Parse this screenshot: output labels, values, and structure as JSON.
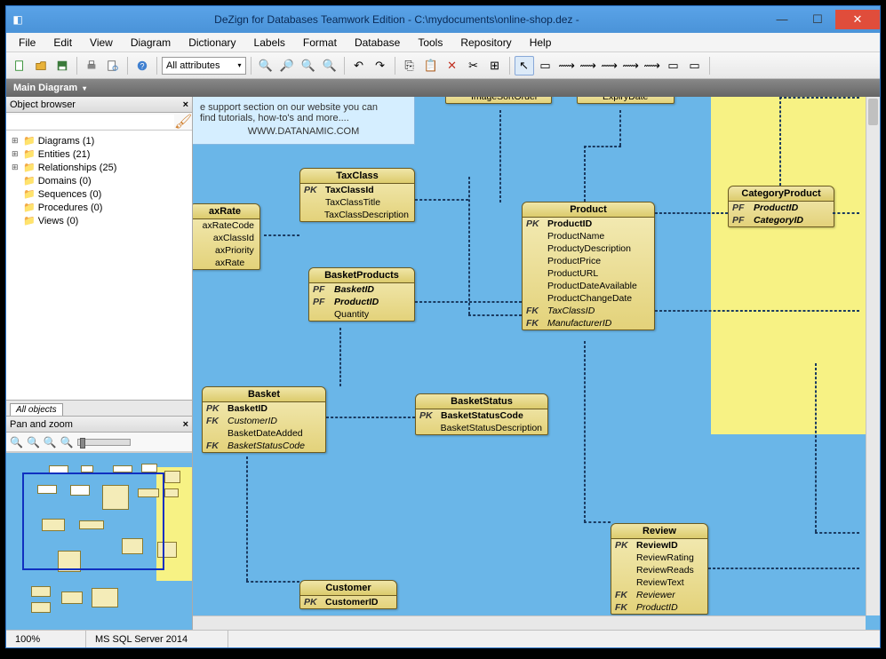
{
  "window": {
    "title": "DeZign for Databases Teamwork Edition - C:\\mydocuments\\online-shop.dez -"
  },
  "menu": [
    "File",
    "Edit",
    "View",
    "Diagram",
    "Dictionary",
    "Labels",
    "Format",
    "Database",
    "Tools",
    "Repository",
    "Help"
  ],
  "toolbar": {
    "attr_combo": "All attributes"
  },
  "diagram_tab": "Main Diagram",
  "left": {
    "object_browser": {
      "title": "Object browser",
      "filter_placeholder": "",
      "items": [
        {
          "exp": "⊞",
          "label": "Diagrams (1)"
        },
        {
          "exp": "⊞",
          "label": "Entities (21)"
        },
        {
          "exp": "⊞",
          "label": "Relationships (25)"
        },
        {
          "exp": "",
          "label": "Domains (0)"
        },
        {
          "exp": "",
          "label": "Sequences (0)"
        },
        {
          "exp": "",
          "label": "Procedures (0)"
        },
        {
          "exp": "",
          "label": "Views (0)"
        }
      ],
      "bottom_tab": "All objects"
    },
    "pan_zoom": {
      "title": "Pan and zoom"
    }
  },
  "canvas": {
    "hint": {
      "line1": "e support section on our website you can",
      "line2": "find tutorials, how-to's and more....",
      "link": "WWW.DATANAMIC.COM"
    },
    "partials": {
      "imageSortOrder": "ImageSortOrder",
      "expiryDate": "ExpiryDate"
    },
    "entities": {
      "taxrate": {
        "title": "axRate",
        "rows": [
          [
            "",
            "axRateCode"
          ],
          [
            "",
            "axClassId"
          ],
          [
            "",
            "axPriority"
          ],
          [
            "",
            "axRate"
          ]
        ]
      },
      "taxclass": {
        "title": "TaxClass",
        "rows": [
          [
            "PK",
            "TaxClassId"
          ],
          [
            "",
            "TaxClassTitle"
          ],
          [
            "",
            "TaxClassDescription"
          ]
        ]
      },
      "basketproducts": {
        "title": "BasketProducts",
        "rows": [
          [
            "PF",
            "BasketID"
          ],
          [
            "PF",
            "ProductID"
          ],
          [
            "",
            "Quantity"
          ]
        ]
      },
      "product": {
        "title": "Product",
        "rows": [
          [
            "PK",
            "ProductID"
          ],
          [
            "",
            "ProductName"
          ],
          [
            "",
            "ProductyDescription"
          ],
          [
            "",
            "ProductPrice"
          ],
          [
            "",
            "ProductURL"
          ],
          [
            "",
            "ProductDateAvailable"
          ],
          [
            "",
            "ProductChangeDate"
          ],
          [
            "FK",
            "TaxClassID"
          ],
          [
            "FK",
            "ManufacturerID"
          ]
        ]
      },
      "categoryproduct": {
        "title": "CategoryProduct",
        "rows": [
          [
            "PF",
            "ProductID"
          ],
          [
            "PF",
            "CategoryID"
          ]
        ]
      },
      "basket": {
        "title": "Basket",
        "rows": [
          [
            "PK",
            "BasketID"
          ],
          [
            "FK",
            "CustomerID"
          ],
          [
            "",
            "BasketDateAdded"
          ],
          [
            "FK",
            "BasketStatusCode"
          ]
        ]
      },
      "basketstatus": {
        "title": "BasketStatus",
        "rows": [
          [
            "PK",
            "BasketStatusCode"
          ],
          [
            "",
            "BasketStatusDescription"
          ]
        ]
      },
      "review": {
        "title": "Review",
        "rows": [
          [
            "PK",
            "ReviewID"
          ],
          [
            "",
            "ReviewRating"
          ],
          [
            "",
            "ReviewReads"
          ],
          [
            "",
            "ReviewText"
          ],
          [
            "FK",
            "Reviewer"
          ],
          [
            "FK",
            "ProductID"
          ]
        ]
      },
      "customer": {
        "title": "Customer",
        "rows": [
          [
            "PK",
            "CustomerID"
          ]
        ]
      }
    }
  },
  "status": {
    "zoom": "100%",
    "db": "MS SQL Server 2014"
  }
}
